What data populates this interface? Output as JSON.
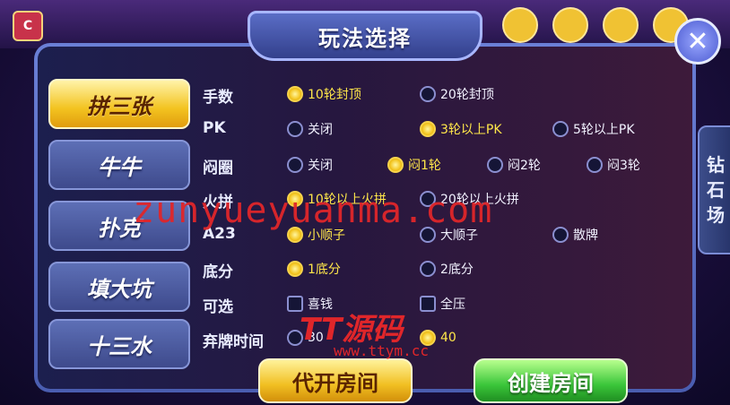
{
  "header": {
    "avatar_text": "C",
    "title": "玩法选择",
    "close": "✕"
  },
  "side_tab": {
    "label": [
      "钻",
      "石",
      "场"
    ]
  },
  "tabs": [
    {
      "label": "拼三张",
      "active": true
    },
    {
      "label": "牛牛",
      "active": false
    },
    {
      "label": "扑克",
      "active": false
    },
    {
      "label": "填大坑",
      "active": false
    },
    {
      "label": "十三水",
      "active": false
    }
  ],
  "rows": [
    {
      "label": "手数",
      "options": [
        {
          "text": "10轮封顶",
          "type": "radio",
          "selected": true
        },
        {
          "text": "20轮封顶",
          "type": "radio",
          "selected": false
        }
      ]
    },
    {
      "label": "PK",
      "options": [
        {
          "text": "关闭",
          "type": "radio",
          "selected": false
        },
        {
          "text": "3轮以上PK",
          "type": "radio",
          "selected": true
        },
        {
          "text": "5轮以上PK",
          "type": "radio",
          "selected": false
        }
      ]
    },
    {
      "label": "闷圈",
      "options": [
        {
          "text": "关闭",
          "type": "radio",
          "selected": false
        },
        {
          "text": "闷1轮",
          "type": "radio",
          "selected": true
        },
        {
          "text": "闷2轮",
          "type": "radio",
          "selected": false
        },
        {
          "text": "闷3轮",
          "type": "radio",
          "selected": false
        }
      ]
    },
    {
      "label": "火拼",
      "options": [
        {
          "text": "10轮以上火拼",
          "type": "radio",
          "selected": true
        },
        {
          "text": "20轮以上火拼",
          "type": "radio",
          "selected": false
        }
      ]
    },
    {
      "label": "A23",
      "options": [
        {
          "text": "小顺子",
          "type": "radio",
          "selected": true
        },
        {
          "text": "大顺子",
          "type": "radio",
          "selected": false
        },
        {
          "text": "散牌",
          "type": "radio",
          "selected": false
        }
      ]
    },
    {
      "label": "底分",
      "options": [
        {
          "text": "1底分",
          "type": "radio",
          "selected": true
        },
        {
          "text": "2底分",
          "type": "radio",
          "selected": false
        }
      ]
    },
    {
      "label": "可选",
      "options": [
        {
          "text": "喜钱",
          "type": "check",
          "selected": false
        },
        {
          "text": "全压",
          "type": "check",
          "selected": false
        }
      ]
    },
    {
      "label": "弃牌时间",
      "options": [
        {
          "text": "30",
          "type": "radio",
          "selected": false
        },
        {
          "text": "40",
          "type": "radio",
          "selected": true
        }
      ]
    }
  ],
  "buttons": {
    "proxy": "代开房间",
    "create": "创建房间"
  },
  "watermark": {
    "main": "zunyueyuanma.com",
    "logo": "TT源码",
    "url": "www.ttym.cc"
  },
  "colors": {
    "active_tab": "#f3c320",
    "inactive_tab": "#3e4a8c",
    "selected_text": "#ffe74a",
    "create_button": "#3bc63a"
  }
}
